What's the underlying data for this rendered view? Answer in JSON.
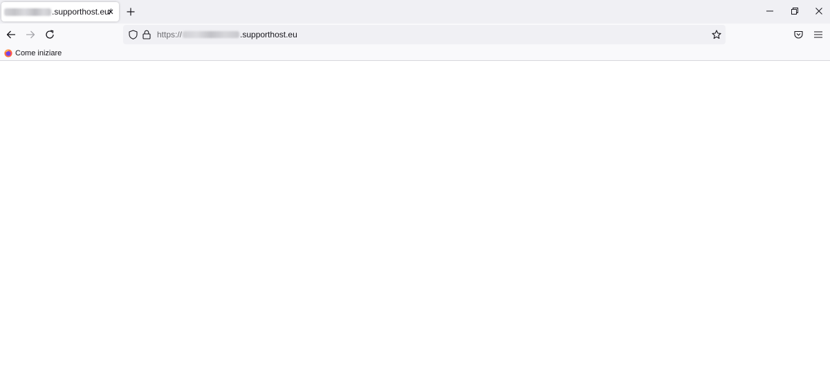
{
  "tab": {
    "title": ".supporthost.eu/",
    "close_icon": "close-icon"
  },
  "window_controls": [
    "minimize-icon",
    "restore-icon",
    "close-icon"
  ],
  "navigation": {
    "back_icon": "arrow-left-icon",
    "forward_icon": "arrow-right-icon",
    "reload_icon": "reload-icon"
  },
  "urlbar": {
    "scheme": "https://",
    "host": ".supporthost.eu",
    "tracking_icon": "shield-icon",
    "security_icon": "lock-icon",
    "bookmark_icon": "star-icon"
  },
  "toolbar": {
    "pocket_icon": "pocket-icon",
    "menu_icon": "hamburger-menu-icon"
  },
  "bookmarks": [
    {
      "label": "Come iniziare",
      "icon": "firefox-icon"
    }
  ],
  "colors": {
    "tabstrip_bg": "#f0f0f4",
    "toolbar_bg": "#f9f9fb",
    "urlbar_bg": "#f0f0f4",
    "text": "#15141a"
  }
}
